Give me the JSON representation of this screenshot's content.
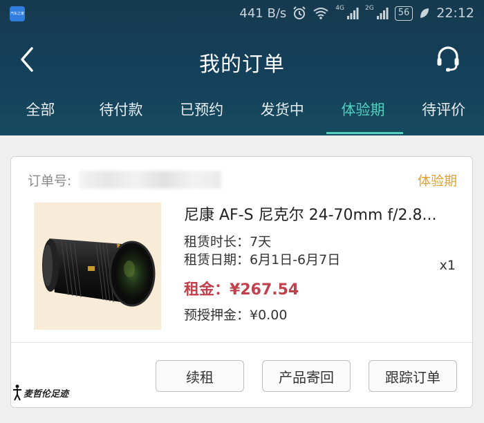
{
  "status_bar": {
    "app_icon_text": "汽车之家",
    "speed": "441 B/s",
    "net1": "4G",
    "net2": "2G",
    "battery": "56",
    "time": "22:12"
  },
  "header": {
    "title": "我的订单",
    "icons": {
      "back": "chevron-left-icon",
      "support": "headset-icon"
    }
  },
  "tabs": [
    {
      "label": "全部",
      "active": false
    },
    {
      "label": "待付款",
      "active": false
    },
    {
      "label": "已预约",
      "active": false
    },
    {
      "label": "发货中",
      "active": false
    },
    {
      "label": "体验期",
      "active": true
    },
    {
      "label": "待评价",
      "active": false
    }
  ],
  "order": {
    "order_no_label": "订单号:",
    "status": "体验期",
    "product_name": "尼康 AF-S 尼克尔 24-70mm f/2.8...",
    "duration_label": "租赁时长：",
    "duration": "7天",
    "dates_label": "租赁日期：",
    "dates": "6月1日-6月7日",
    "quantity": "x1",
    "rent_label": "租金：",
    "rent": "¥267.54",
    "deposit_label": "预授押金：",
    "deposit": "¥0.00"
  },
  "actions": {
    "renew": "续租",
    "return": "产品寄回",
    "track": "跟踪订单"
  },
  "watermark": "麦哲伦足迹",
  "colors": {
    "header_bg": "#163a4f",
    "active_tab": "#53d0c0",
    "status_orange": "#e0a234",
    "rent_red": "#c0404c"
  }
}
